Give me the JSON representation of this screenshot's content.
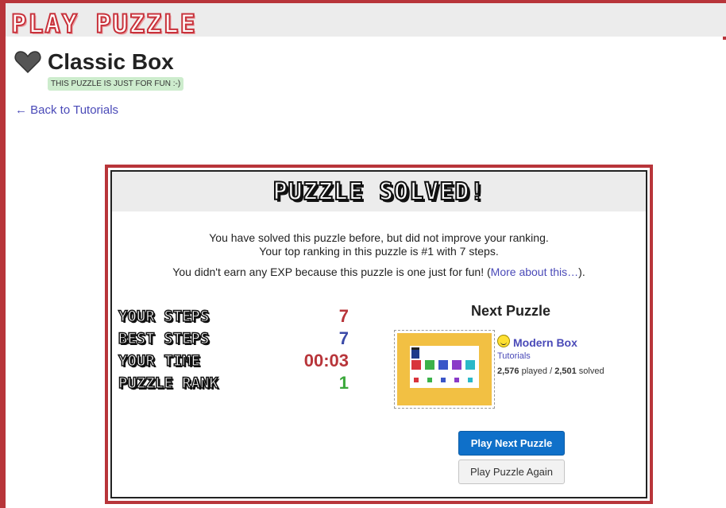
{
  "header": {
    "logo": "PLAY PUZZLE"
  },
  "puzzle": {
    "title": "Classic Box",
    "badge": "THIS PUZZLE IS JUST FOR FUN :-)",
    "back_link": "← Back to Tutorials"
  },
  "modal": {
    "title": "PUZZLE SOLVED!",
    "message_line1": "You have solved this puzzle before, but did not improve your ranking.",
    "message_line2": "Your top ranking in this puzzle is #1 with 7 steps.",
    "message_line3_prefix": "You didn't earn any EXP because this puzzle is one just for fun! (",
    "message_line3_link": "More about this…",
    "message_line3_suffix": ").",
    "stats": [
      {
        "label": "YOUR STEPS",
        "value": "7",
        "color": "#b8353a"
      },
      {
        "label": "BEST STEPS",
        "value": "7",
        "color": "#3b4aa8"
      },
      {
        "label": "YOUR TIME",
        "value": "00:03",
        "color": "#b8353a"
      },
      {
        "label": "PUZZLE RANK",
        "value": "1",
        "color": "#3aa83a"
      }
    ],
    "next": {
      "heading": "Next Puzzle",
      "name": "Modern Box",
      "category": "Tutorials",
      "played": "2,576",
      "played_label": "played /",
      "solved": "2,501",
      "solved_label": "solved"
    },
    "buttons": {
      "play_next": "Play Next Puzzle",
      "play_again": "Play Puzzle Again"
    }
  },
  "colors": {
    "accent": "#b8353a",
    "link": "#4a4ab8",
    "primary_button": "#0f70c9"
  }
}
